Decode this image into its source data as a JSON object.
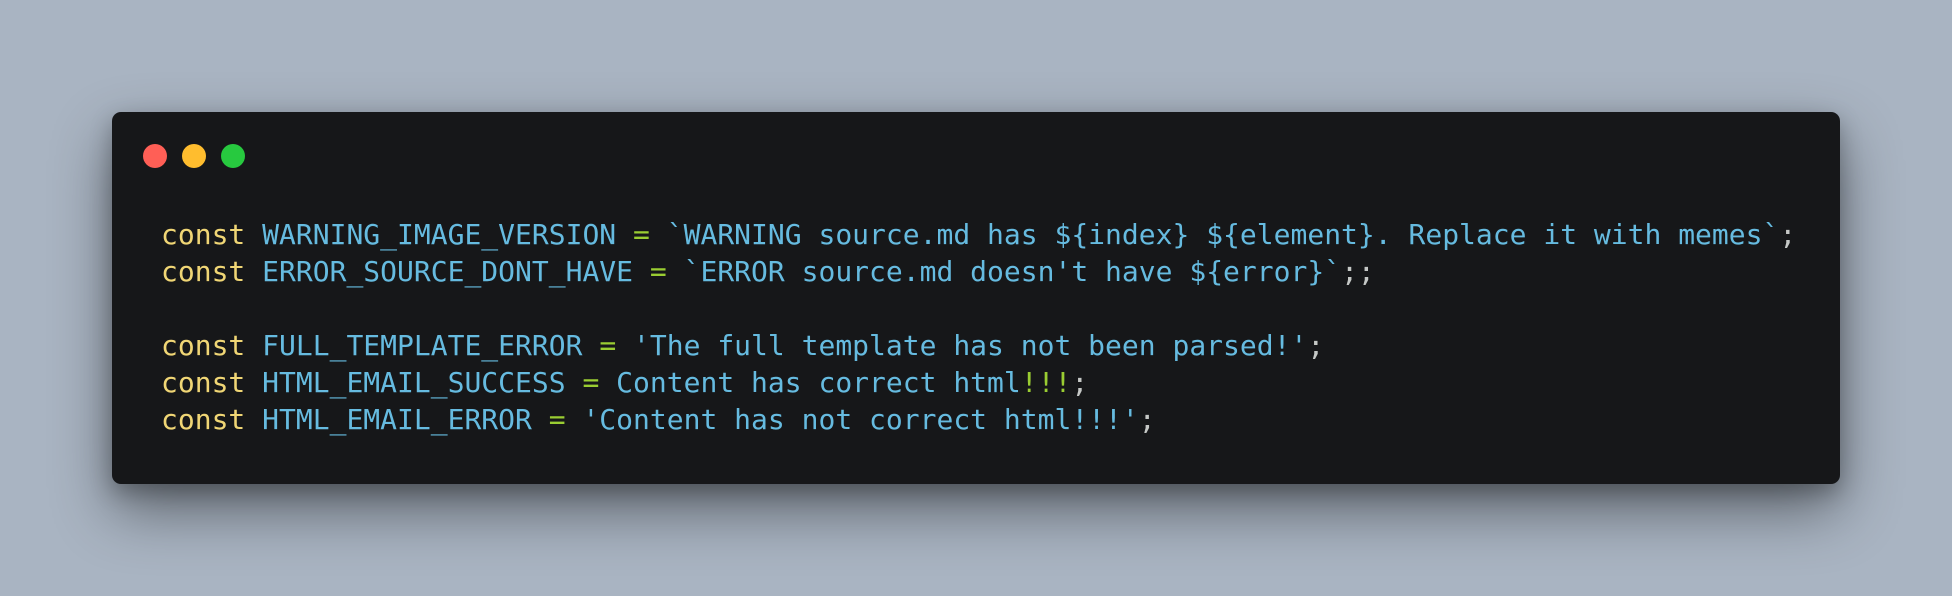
{
  "window": {
    "buttons": {
      "close": "#ff5f56",
      "minimize": "#ffbd2e",
      "maximize": "#27c93f"
    }
  },
  "colors": {
    "background": "#a9b4c2",
    "editor": "#161719",
    "keyword": "#f0d675",
    "identifier": "#66bbe0",
    "operator": "#9acd32",
    "punctuation": "#c5c8c6"
  },
  "code": {
    "lines": [
      {
        "keyword": "const",
        "name": "WARNING_IMAGE_VERSION",
        "op": "=",
        "value": "`WARNING source.md has ${index} ${element}. Replace it with memes`",
        "end": ";"
      },
      {
        "keyword": "const",
        "name": "ERROR_SOURCE_DONT_HAVE",
        "op": "=",
        "value": "`ERROR source.md doesn't have ${error}`",
        "end": ";;"
      },
      {
        "keyword": "const",
        "name": "FULL_TEMPLATE_ERROR",
        "op": "=",
        "value": "'The full template has not been parsed!'",
        "end": ";"
      },
      {
        "keyword": "const",
        "name": "HTML_EMAIL_SUCCESS",
        "op": "=",
        "value": "Content has correct html",
        "value_bang": "!!!",
        "end": ";"
      },
      {
        "keyword": "const",
        "name": "HTML_EMAIL_ERROR",
        "op": "=",
        "value": "'Content has not correct html!!!'",
        "end": ";"
      }
    ]
  }
}
